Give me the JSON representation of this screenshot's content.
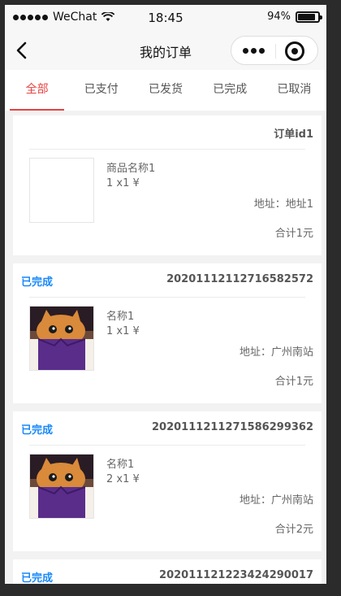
{
  "status_bar": {
    "carrier": "WeChat",
    "time": "18:45",
    "battery": "94%",
    "battery_level": 0.94
  },
  "navbar": {
    "title": "我的订单"
  },
  "tabs": [
    {
      "label": "全部",
      "active": true
    },
    {
      "label": "已支付",
      "active": false
    },
    {
      "label": "已发货",
      "active": false
    },
    {
      "label": "已完成",
      "active": false
    },
    {
      "label": "已取消",
      "active": false
    }
  ],
  "orders": [
    {
      "status": "",
      "id": "订单id1",
      "name": "商品名称1",
      "qty": "1 x1 ¥",
      "address": "地址：地址1",
      "total": "合计1元",
      "has_image": false
    },
    {
      "status": "已完成",
      "id": "20201112112716582572",
      "name": "名称1",
      "qty": "1 x1 ¥",
      "address": "地址：广州南站",
      "total": "合计1元",
      "has_image": true
    },
    {
      "status": "已完成",
      "id": "20201112112715862993​62",
      "name": "名称1",
      "qty": "2 x1 ¥",
      "address": "地址：广州南站",
      "total": "合计2元",
      "has_image": true
    },
    {
      "status": "已完成",
      "id": "20201112122342429001​7",
      "name": "",
      "qty": "",
      "address": "",
      "total": "",
      "has_image": false
    }
  ]
}
